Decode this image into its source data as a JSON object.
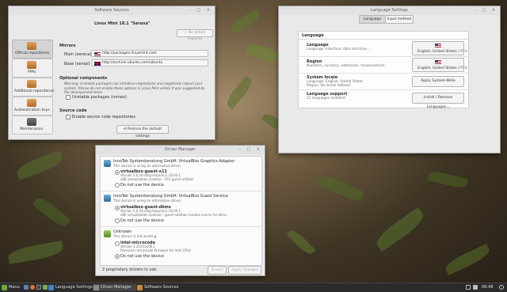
{
  "software_sources": {
    "title": "Software Sources",
    "heading": "Linux Mint 18.1 \"Serena\"",
    "no_action_button": "No action required",
    "sidebar": [
      {
        "label": "Official repositories"
      },
      {
        "label": "PPAs"
      },
      {
        "label": "Additional repositories"
      },
      {
        "label": "Authentication keys"
      },
      {
        "label": "Maintenance"
      }
    ],
    "mirrors_heading": "Mirrors",
    "main_label": "Main (serena)",
    "main_value": "http://packages.linuxmint.com",
    "base_label": "Base (xenial)",
    "base_value": "http://archive.ubuntu.com/ubuntu",
    "optional_heading": "Optional components",
    "warning": "Warning: Unstable packages can introduce regressions and negatively impact your system. Please do not enable these options in Linux Mint unless it was suggested by the development team.",
    "unstable_label": "Unstable packages (romeo)",
    "source_heading": "Source code",
    "source_label": "Enable source code repositories",
    "restore_button": "Restore the default settings"
  },
  "language_settings": {
    "title": "Language Settings",
    "tabs": [
      "Language",
      "Input method"
    ],
    "section": "Language",
    "rows": [
      {
        "title": "Language",
        "subtitle": "Language, interface, date and time...",
        "button": "English, United States",
        "code": "UTF-8"
      },
      {
        "title": "Region",
        "subtitle": "Numbers, currency, addresses, measurement...",
        "button": "English, United States",
        "code": "UTF-8"
      },
      {
        "title": "System locale",
        "subtitle": "Language: English, United States\nRegion: No locale defined",
        "button": "Apply System-Wide",
        "code": ""
      },
      {
        "title": "Language support",
        "subtitle": "21 languages installed",
        "button": "Install / Remove Languages...",
        "code": ""
      }
    ]
  },
  "driver_manager": {
    "title": "Driver Manager",
    "devices": [
      {
        "vendor": "InnoTek Systemberatung GmbH: VirtualBox Graphics Adapter",
        "status": "This device is using an alternative driver.",
        "options": [
          {
            "name": "virtualbox-guest-x11",
            "version": "Version 5.0.24-dfsg-0ubuntu1.16.04.1",
            "desc": "x86 virtualization solution - X11 guest utilities",
            "selected": true
          },
          {
            "name": "Do not use the device",
            "version": "",
            "desc": "",
            "selected": false
          }
        ]
      },
      {
        "vendor": "InnoTek Systemberatung GmbH: VirtualBox Guest Service",
        "status": "This device is using an alternative driver.",
        "options": [
          {
            "name": "virtualbox-guest-dkms",
            "version": "Version 5.0.24-dfsg-0ubuntu1.16.04.1",
            "desc": "x86 virtualization solution - guest addition module source for dkms",
            "selected": true
          },
          {
            "name": "Do not use the device",
            "version": "",
            "desc": "",
            "selected": false
          }
        ]
      },
      {
        "vendor": "Unknown",
        "status": "This device is not working.",
        "options": [
          {
            "name": "intel-microcode",
            "version": "Version 3.20151106.1",
            "desc": "Processor microcode firmware for Intel CPUs",
            "selected": false
          },
          {
            "name": "Do not use the device",
            "version": "",
            "desc": "",
            "selected": true
          }
        ]
      }
    ],
    "status": "2 proprietary drivers in use.",
    "revert_button": "Revert",
    "apply_button": "Apply Changes"
  },
  "taskbar": {
    "menu": "Menu",
    "windows": [
      "Language Settings",
      "Driver Manager",
      "Software Sources"
    ],
    "clock": "06:48"
  },
  "colors": {
    "accent_green": "#6a9a2a",
    "taskbar_bg": "#2b2b2b"
  }
}
